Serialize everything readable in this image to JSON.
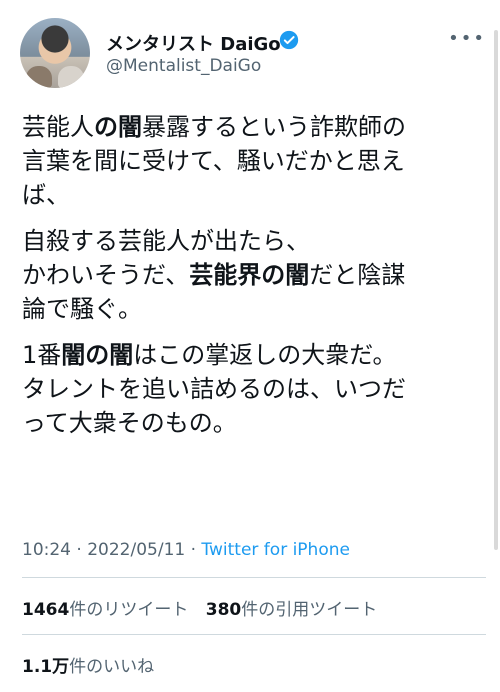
{
  "user": {
    "name": "メンタリスト DaiGo",
    "handle": "@Mentalist_DaiGo",
    "more_icon": "more-horizontal-icon",
    "verified_color": "#1d9bf0"
  },
  "tweet": {
    "p1": {
      "a": "芸能人",
      "b": "の闇",
      "c": "暴露するという詐欺師の",
      "d": "言葉を間に受けて、騒いだかと思え",
      "e": "ば、"
    },
    "p2": {
      "a": "自殺する芸能人が出たら、",
      "b": "かわいそうだ、",
      "c": "芸能界の闇",
      "d": "だと陰謀",
      "e": "論で騒ぐ。"
    },
    "p3": {
      "a": "1番",
      "b": "闇の闇",
      "c": "はこの掌返しの大衆だ。",
      "d": "タレントを追い詰めるのは、いつだ",
      "e": "って大衆そのもの。"
    }
  },
  "meta": {
    "time": "10:24",
    "sep1": " · ",
    "date": "2022/05/11",
    "sep2": " · ",
    "source": "Twitter for iPhone"
  },
  "stats": {
    "retweets": "1464",
    "retweets_label": "件のリツイート",
    "quotes": "380",
    "quotes_label": "件の引用ツイート",
    "likes": "1.1万",
    "likes_label": "件のいいね"
  }
}
